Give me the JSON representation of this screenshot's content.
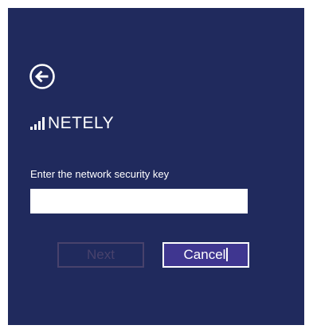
{
  "colors": {
    "panel_background": "#202a5d",
    "text": "#ffffff",
    "input_background": "#ffffff",
    "next_disabled": "#48426c",
    "cancel_background": "#3f3690"
  },
  "header": {
    "back_icon": "back-arrow-icon"
  },
  "network": {
    "signal_icon": "wifi-signal-icon",
    "name": "NETELY"
  },
  "form": {
    "key_label": "Enter the network security key",
    "key_value": "",
    "key_placeholder": ""
  },
  "buttons": {
    "next_label": "Next",
    "next_disabled": true,
    "cancel_label": "Cancel"
  }
}
